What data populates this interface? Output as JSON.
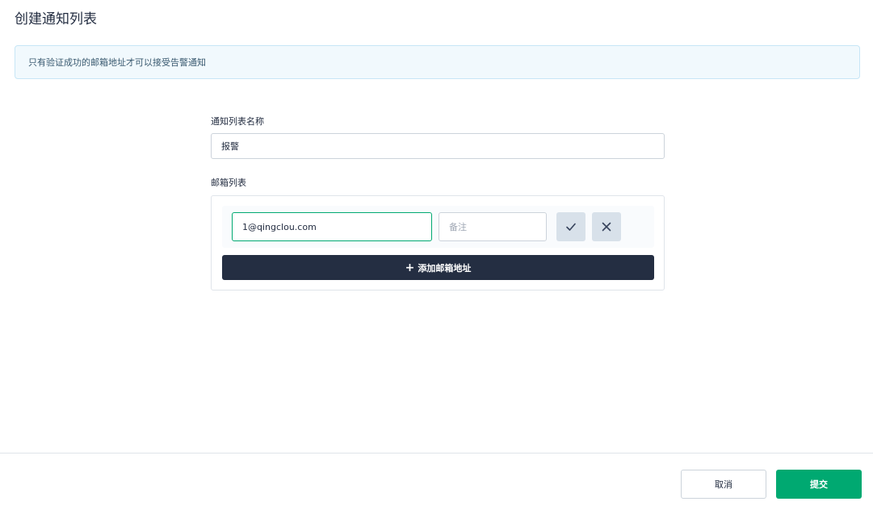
{
  "dialog": {
    "title": "创建通知列表"
  },
  "alert": {
    "message": "只有验证成功的邮箱地址才可以接受告警通知"
  },
  "form": {
    "name_label": "通知列表名称",
    "name_value": "报警",
    "email_list_label": "邮箱列表",
    "emails": [
      {
        "address": "1@qingclou.com",
        "note_placeholder": "备注",
        "note_value": ""
      }
    ],
    "add_email_label": "添加邮箱地址",
    "add_email_icon": "plus-icon",
    "confirm_icon": "check-icon",
    "remove_icon": "close-icon"
  },
  "footer": {
    "cancel_label": "取消",
    "submit_label": "提交"
  },
  "colors": {
    "primary_green": "#00a971",
    "dark_button": "#242e42",
    "alert_bg": "#f1f9fd",
    "alert_border": "#c7e6f6",
    "icon_button_bg": "#d8e1ea"
  }
}
